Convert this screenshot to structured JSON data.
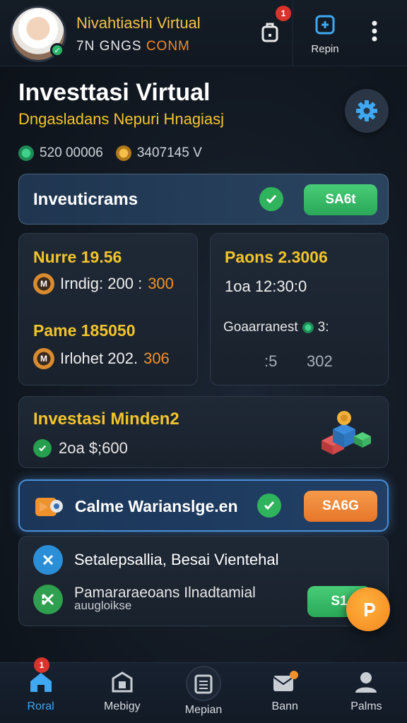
{
  "header": {
    "user_name": "Nivahtiashi Virtual",
    "user_id_prefix": "7N GNGS ",
    "user_id_suffix": "CONM",
    "notification_count": "1",
    "repin_label": "Repin"
  },
  "page": {
    "title": "Investtasi Virtual",
    "subtitle": "Dngasladans Nepuri Hnagiasj",
    "stat_1": "520 00006",
    "stat_2": "3407145 V"
  },
  "banner_1": {
    "label": "Inveuticrams",
    "button": "SA6t"
  },
  "card_left": {
    "title_1": "Nurre 19.56",
    "line_1_label": "Irndig: 200 :",
    "line_1_value": "300",
    "title_2": "Pame 185050",
    "line_2_label": "Irlohet 202.",
    "line_2_value": "306",
    "badge_glyph": "M"
  },
  "card_right": {
    "title": "Paons 2.3006",
    "line_1": "1oa  12:30:0",
    "line_2": "Goaarranest",
    "line_2_suffix": "3:",
    "line_3_a": ":5",
    "line_3_b": "302"
  },
  "invest_card": {
    "title": "Investasi Minden2",
    "value": "2oa $;600"
  },
  "highlight_row": {
    "label": "Calme Warianslge.en",
    "button": "SA6G"
  },
  "list_card": {
    "item_1": "Setalepsallia, Besai Vientehal",
    "item_2_line_1": "Pamararaeoans Ilnadtamial",
    "item_2_line_2": "auugloikse",
    "button": "S1"
  },
  "nav": {
    "badge": "1",
    "items": [
      {
        "label": "Roral"
      },
      {
        "label": "Mebigy"
      },
      {
        "label": "Mepian"
      },
      {
        "label": "Bann"
      },
      {
        "label": "Palms"
      }
    ]
  },
  "colors": {
    "accent_gold": "#f2c42c",
    "accent_blue": "#3fa8f2",
    "success_green": "#2fb35c",
    "accent_orange": "#f08a2c",
    "badge_red": "#d9342b"
  }
}
